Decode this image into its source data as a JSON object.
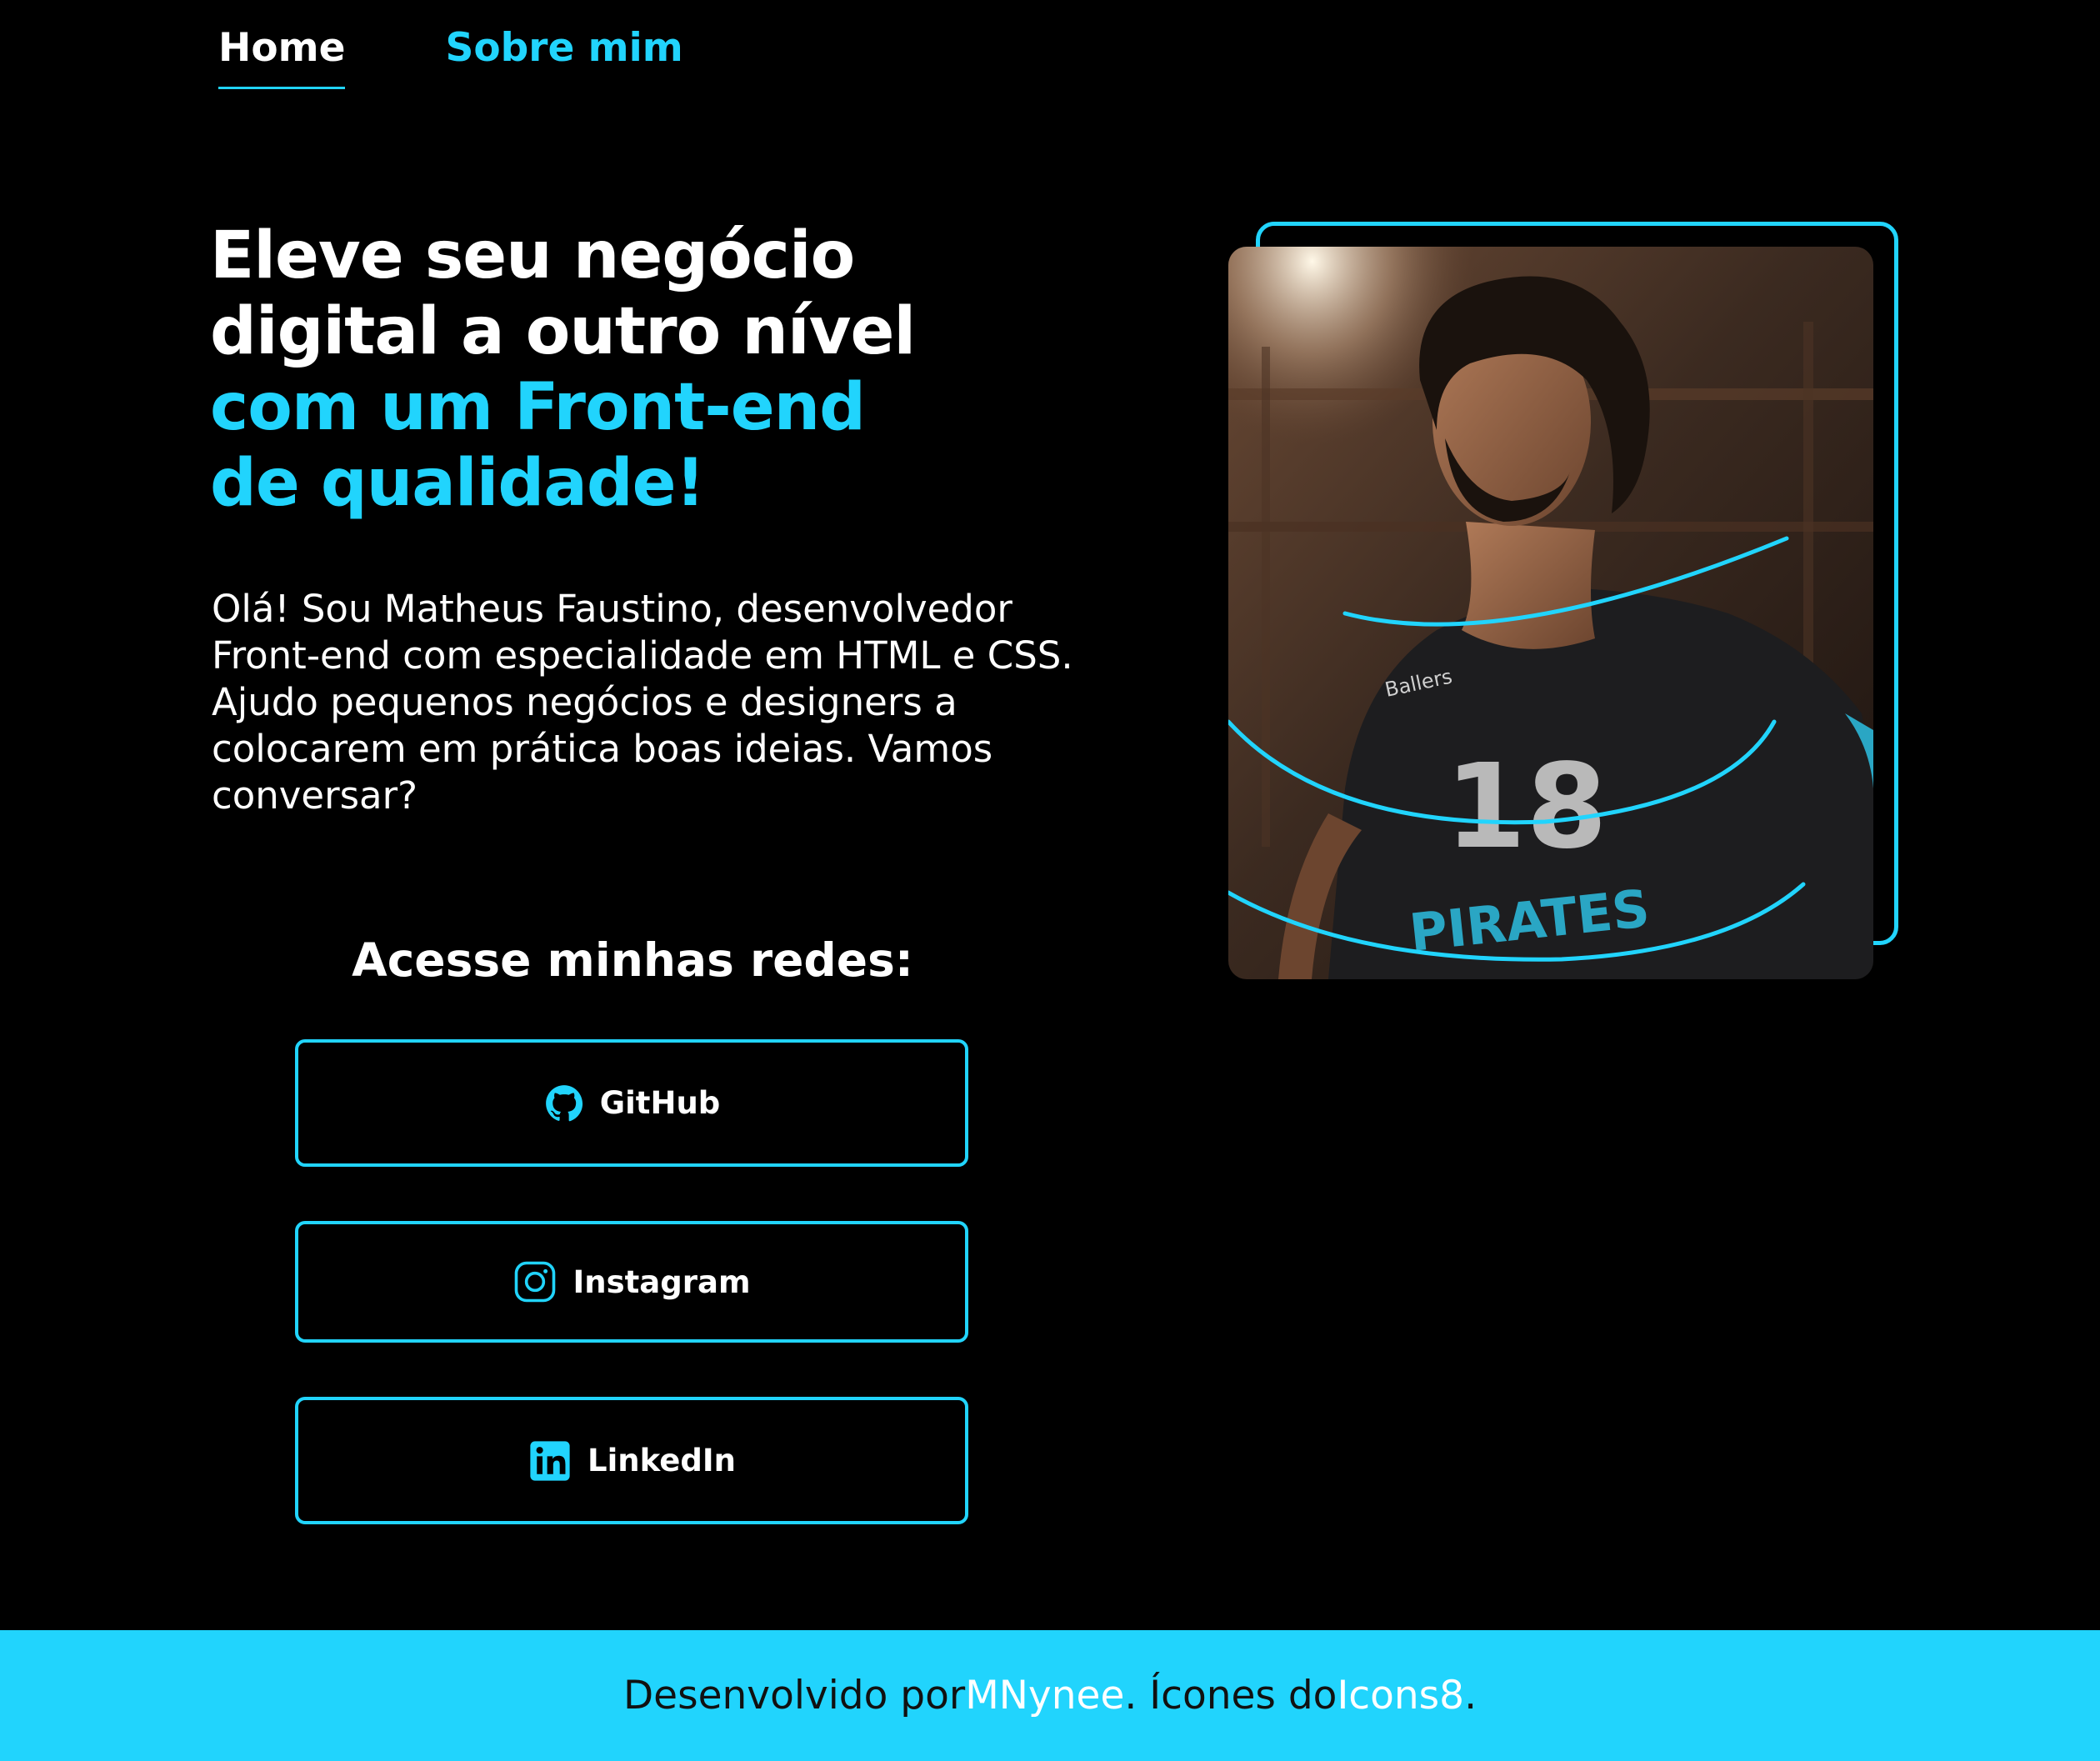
{
  "nav": {
    "home_label": "Home",
    "about_label": "Sobre mim"
  },
  "hero": {
    "title_line1": "Eleve seu negócio",
    "title_line2": "digital a outro nível",
    "title_accent_line1": "com um Front-end",
    "title_accent_line2": "de qualidade!",
    "intro": "Olá! Sou Matheus Faustino, desenvolvedor Front-end com especialidade em HTML e CSS. Ajudo pequenos negócios e designers a colocarem em prática boas ideias. Vamos conversar?"
  },
  "social": {
    "heading": "Acesse minhas redes:",
    "links": [
      {
        "label": "GitHub",
        "icon": "github-icon"
      },
      {
        "label": "Instagram",
        "icon": "instagram-icon"
      },
      {
        "label": "LinkedIn",
        "icon": "linkedin-icon"
      }
    ]
  },
  "photo": {
    "jersey_number": "18",
    "jersey_sponsor": "Ballers",
    "jersey_team": "PIRATES"
  },
  "footer": {
    "prefix": "Desenvolvido por ",
    "author": "MNynee",
    "middle": ". Ícones do ",
    "icons_source": "Icons8",
    "suffix": "."
  },
  "colors": {
    "accent": "#21d4fd",
    "background": "#000000",
    "text": "#ffffff"
  }
}
